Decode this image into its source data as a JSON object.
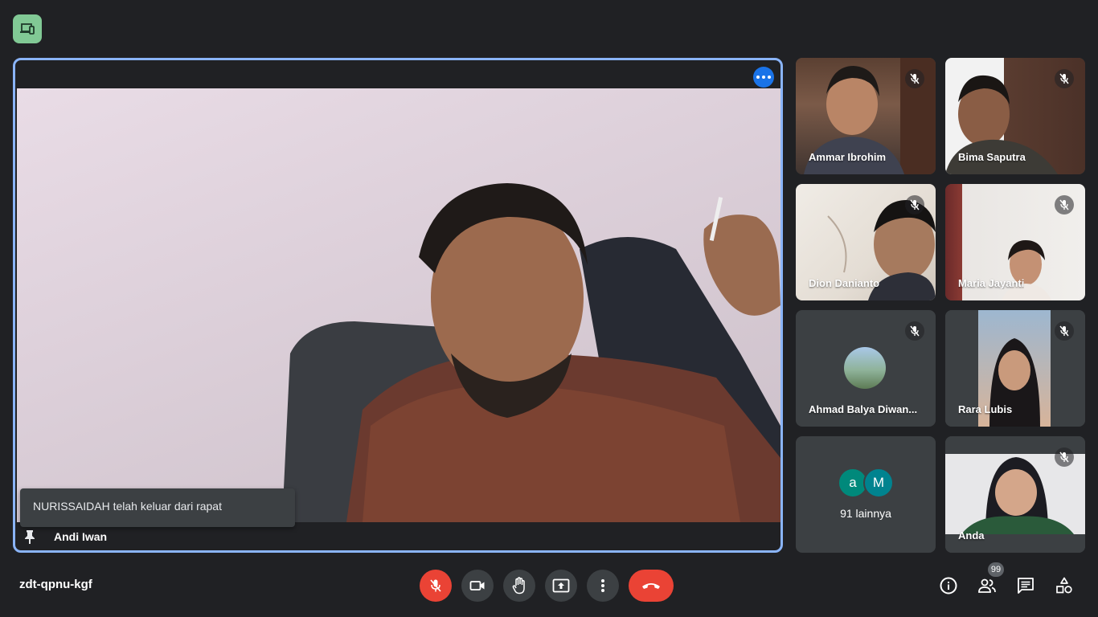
{
  "main": {
    "presenter_name": "Andi Iwan",
    "toast": "NURISSAIDAH telah keluar dari rapat"
  },
  "participants": [
    {
      "name": "Ammar Ibrohim",
      "muted": true
    },
    {
      "name": "Bima Saputra",
      "muted": true
    },
    {
      "name": "Dion Danianto",
      "muted": true
    },
    {
      "name": "Maria Jayanti",
      "muted": true
    },
    {
      "name": "Ahmad Balya Diwan...",
      "muted": true
    },
    {
      "name": "Rara Lubis",
      "muted": true
    },
    {
      "name": "Anda",
      "muted": true
    }
  ],
  "others_tile": {
    "avatars": [
      {
        "letter": "a",
        "color": "#00897b"
      },
      {
        "letter": "M",
        "color": "#00838f"
      }
    ],
    "label": "91 lainnya"
  },
  "bottom_bar": {
    "meeting_code": "zdt-qpnu-kgf",
    "people_count": "99"
  },
  "colors": {
    "background": "#202124",
    "active_border": "#8ab4f8",
    "accent_blue": "#1a73e8",
    "danger": "#ea4335",
    "companion_badge": "#81c995"
  },
  "icons": [
    "companion-mode-icon",
    "more-options-icon",
    "pin-icon",
    "mic-off-icon",
    "camera-icon",
    "raise-hand-icon",
    "present-screen-icon",
    "more-vert-icon",
    "hang-up-icon",
    "info-icon",
    "people-icon",
    "chat-icon",
    "activities-icon"
  ]
}
